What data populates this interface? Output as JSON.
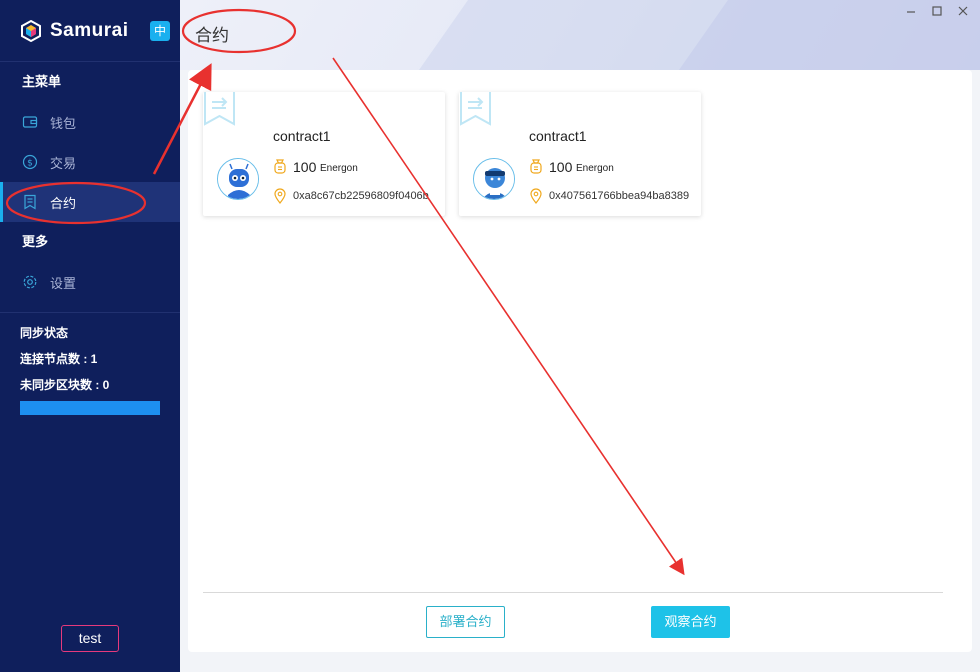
{
  "brand": {
    "name": "Samurai",
    "lang": "中"
  },
  "sidebar": {
    "main_menu_title": "主菜单",
    "items": [
      {
        "label": "钱包",
        "icon": "wallet-icon"
      },
      {
        "label": "交易",
        "icon": "transaction-icon"
      },
      {
        "label": "合约",
        "icon": "contract-icon",
        "active": true
      }
    ],
    "more_title": "更多",
    "more_items": [
      {
        "label": "设置",
        "icon": "gear-icon"
      }
    ],
    "sync": {
      "title": "同步状态",
      "nodes": "连接节点数 : 1",
      "unsynced": "未同步区块数 : 0",
      "progress": 1.0
    },
    "account": "test"
  },
  "header": {
    "title": "合约"
  },
  "contracts": [
    {
      "name": "contract1",
      "amount": "100",
      "unit": "Energon",
      "address": "0xa8c67cb22596809f0406b"
    },
    {
      "name": "contract1",
      "amount": "100",
      "unit": "Energon",
      "address": "0x407561766bbea94ba8389"
    }
  ],
  "actions": {
    "deploy": "部署合约",
    "observe": "观察合约"
  },
  "colors": {
    "sidebar": "#0f1f5c",
    "accent": "#1ec2e8",
    "annotation": "#e8312f",
    "account_border": "#e6397c"
  }
}
